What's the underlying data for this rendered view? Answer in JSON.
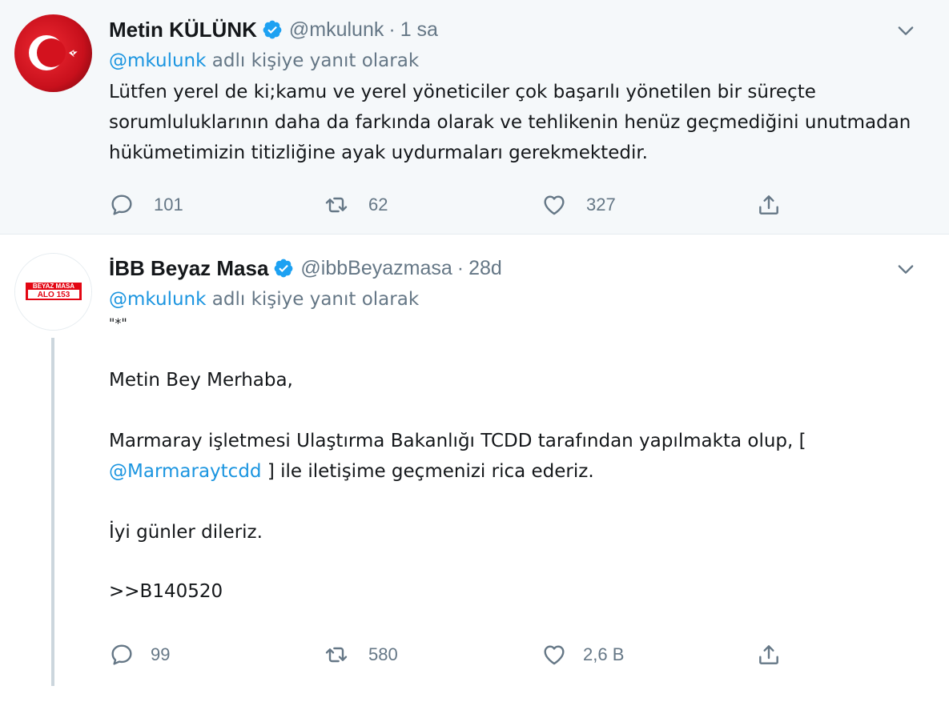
{
  "tweets": [
    {
      "name": "Metin KÜLÜNK",
      "handle": "@mkulunk",
      "dot": "·",
      "time": "1 sa",
      "reply_prefix": "@mkulunk",
      "reply_suffix": " adlı kişiye yanıt olarak",
      "text": "Lütfen yerel de ki;kamu ve yerel yöneticiler çok başarılı yönetilen bir süreçte sorumluluklarının daha da farkında olarak ve tehlikenin henüz geçmediğini unutmadan hükümetimizin titizliğine ayak uydurmaları gerekmektedir.",
      "replies": "101",
      "retweets": "62",
      "likes": "327"
    },
    {
      "name": "İBB Beyaz Masa",
      "handle": "@ibbBeyazmasa",
      "dot": "·",
      "time": "28d",
      "reply_prefix": "@mkulunk",
      "reply_suffix": " adlı kişiye yanıt olarak",
      "avatar_line1": "BEYAZ MASA",
      "avatar_line2": "ALO 153",
      "quote": "\"*\"",
      "greeting": "Metin Bey Merhaba,",
      "para1": "Marmaray işletmesi Ulaştırma Bakanlığı TCDD tarafından yapılmakta olup, [",
      "mention": "@Marmaraytcdd",
      "para1_end": " ] ile iletişime geçmenizi rica ederiz.",
      "closing": "İyi günler dileriz.",
      "code": ">>B140520",
      "replies": "99",
      "retweets": "580",
      "likes": "2,6 B"
    }
  ],
  "colors": {
    "accent": "#1b95e0",
    "muted": "#657786",
    "text": "#14171a",
    "highlight_bg": "#f5f8fa",
    "beyaz_masa_red": "#e30613"
  }
}
